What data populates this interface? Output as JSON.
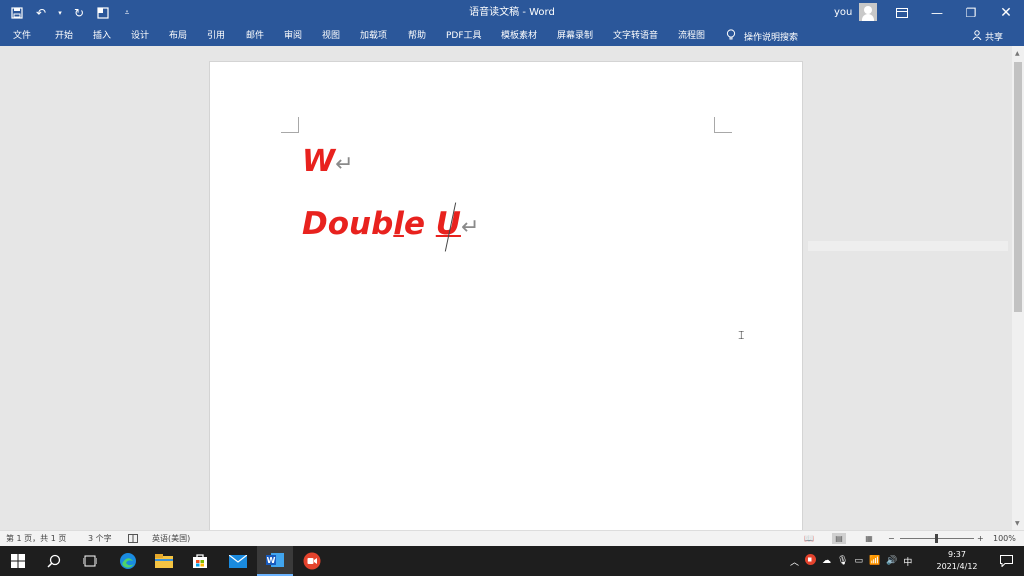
{
  "titlebar": {
    "doc_title": "语音读文稿  -  Word",
    "user": "you",
    "qat_icons": [
      "save-icon",
      "undo-icon",
      "redo-icon",
      "layout-icon",
      "customize-icon"
    ],
    "window_icons": [
      "ribbon-display-icon",
      "minimize-icon",
      "restore-icon",
      "close-icon"
    ]
  },
  "ribbon": {
    "tabs": [
      "文件",
      "开始",
      "插入",
      "设计",
      "布局",
      "引用",
      "邮件",
      "审阅",
      "视图",
      "加载项",
      "帮助",
      "PDF工具",
      "模板素材",
      "屏幕录制",
      "文字转语音",
      "流程图"
    ],
    "search_label": "操作说明搜索",
    "share_label": "共享"
  },
  "document": {
    "line1": "W",
    "line2_part1": "Doub",
    "line2_underlined1": "l",
    "line2_part2": "e ",
    "line2_underlined2": "U",
    "paragraph_mark": "↵",
    "text_color": "#e8221e"
  },
  "statusbar": {
    "page_info": "第 1 页，共 1 页",
    "word_count": "3 个字",
    "language": "英语(美国)",
    "zoom": "100%",
    "zoom_minus": "−",
    "zoom_plus": "+"
  },
  "taskbar": {
    "apps": [
      "windows-start-icon",
      "search-icon",
      "task-view-icon",
      "edge-icon",
      "file-explorer-icon",
      "store-icon",
      "mail-icon",
      "word-icon",
      "recorder-icon"
    ],
    "ime": "中",
    "time": "9:37",
    "date": "2021/4/12"
  },
  "colors": {
    "accent": "#2b579a",
    "taskbar": "#1e1e1e"
  }
}
